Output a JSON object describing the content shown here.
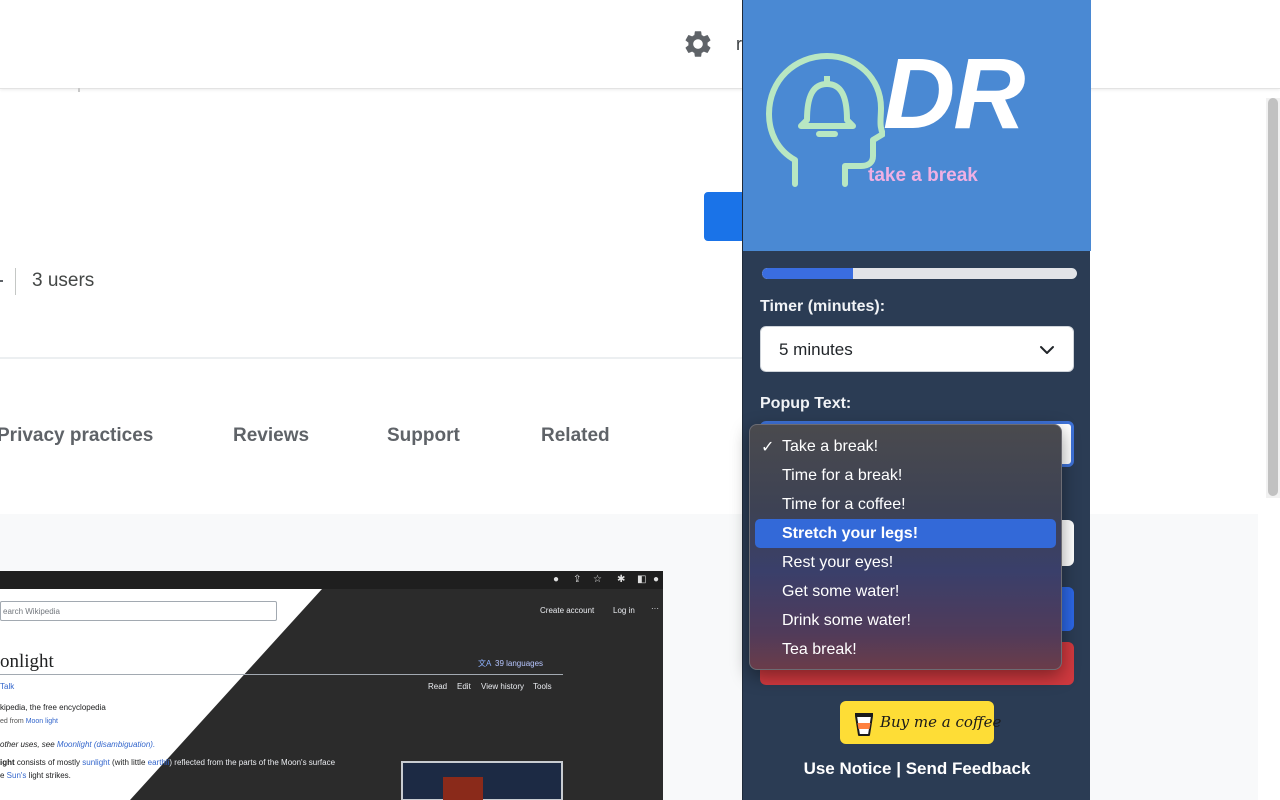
{
  "store": {
    "topbar_letter": "r",
    "users": "3 users",
    "tabs": [
      "Privacy practices",
      "Reviews",
      "Support",
      "Related"
    ]
  },
  "screenshot": {
    "search_placeholder": "earch Wikipedia",
    "create_account": "Create account",
    "log_in": "Log in",
    "title": "onlight",
    "languages": "39 languages",
    "talk": "Talk",
    "actions": [
      "Read",
      "Edit",
      "View history",
      "Tools"
    ],
    "line1": "kipedia, the free encyclopedia",
    "line2_prefix": "ed from ",
    "line2_link": "Moon light",
    "line3_prefix": "other uses, see ",
    "line3_link": "Moonlight (disambiguation).",
    "line4_a": "ight",
    "line4_b": " consists of mostly ",
    "line4_link1": "sunlight",
    "line4_c": " (with little ",
    "line4_link2": "earthli",
    "line4_d": ") reflected from the parts of the Moon's surface",
    "line5_prefix": "e ",
    "line5_link": "Sun's",
    "line5_suffix": " light strikes."
  },
  "popup": {
    "logo_letters": "DR",
    "tagline": "take a break",
    "progress_fraction": 0.29,
    "timer_label": "Timer (minutes):",
    "timer_value": "5 minutes",
    "popup_text_label": "Popup Text:",
    "dropdown_options": [
      "Take a break!",
      "Time for a break!",
      "Time for a coffee!",
      "Stretch your legs!",
      "Rest your eyes!",
      "Get some water!",
      "Drink some water!",
      "Tea break!"
    ],
    "checked_option": "Take a break!",
    "highlighted_option": "Stretch your legs!",
    "bmc_label": "Buy me a coffee",
    "footer_use_notice": "Use Notice",
    "footer_sep": "|",
    "footer_feedback": "Send Feedback",
    "colors": {
      "header": "#4a89d3",
      "body": "#2b3c54",
      "progress": "#3a6de0",
      "tagline": "#f0b0e4",
      "logo_outline": "#b8e7c2",
      "highlight": "#3369d8",
      "bmc": "#fedd36"
    }
  }
}
